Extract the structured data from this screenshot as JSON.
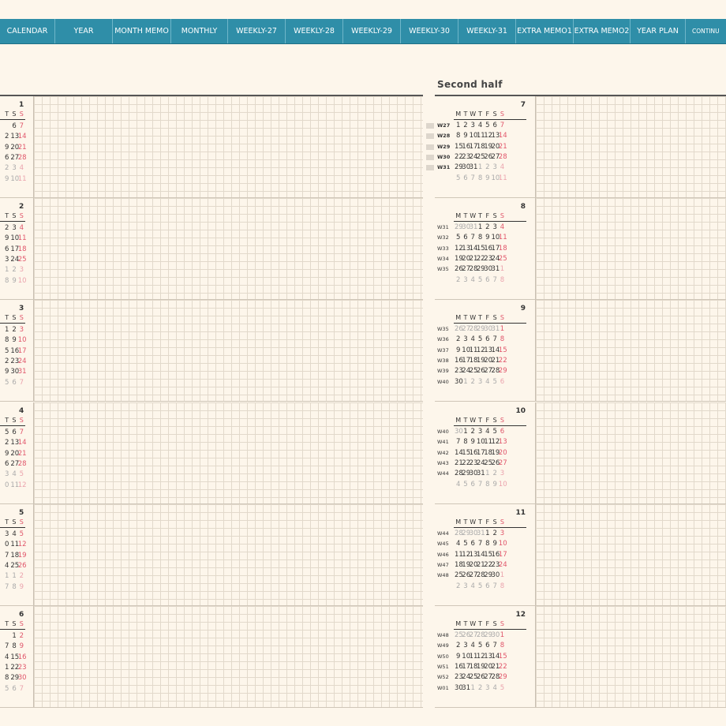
{
  "tabs": [
    "CALENDAR",
    "YEAR",
    "MONTH MEMO",
    "MONTHLY",
    "WEEKLY-27",
    "WEEKLY-28",
    "WEEKLY-29",
    "WEEKLY-30",
    "WEEKLY-31",
    "EXTRA MEMO1",
    "EXTRA MEMO2",
    "YEAR PLAN",
    "CONTINU"
  ],
  "second_half_title": "Second half",
  "weekday_headers": [
    "M",
    "T",
    "W",
    "T",
    "F",
    "S",
    "S"
  ],
  "colors": {
    "tab_bar": "#2f8ea8",
    "background": "#fdf6eb",
    "sunday": "#e0556a",
    "muted": "#aaaaaa"
  },
  "first_half": [
    {
      "month": "1",
      "header": [
        "T",
        "S",
        "S"
      ],
      "rows": [
        [
          {
            "t": "6"
          },
          {
            "t": "7",
            "s": 1
          }
        ],
        [
          {
            "t": "2"
          },
          {
            "t": "13"
          },
          {
            "t": "14",
            "s": 1
          }
        ],
        [
          {
            "t": "9"
          },
          {
            "t": "20"
          },
          {
            "t": "21",
            "s": 1
          }
        ],
        [
          {
            "t": "6"
          },
          {
            "t": "27"
          },
          {
            "t": "28",
            "s": 1
          }
        ],
        [
          {
            "t": "2",
            "o": 1
          },
          {
            "t": "3",
            "o": 1
          },
          {
            "t": "4",
            "o": 1,
            "s": 1
          }
        ],
        [
          {
            "t": "9",
            "o": 1
          },
          {
            "t": "10",
            "o": 1
          },
          {
            "t": "11",
            "o": 1,
            "s": 1
          }
        ]
      ]
    },
    {
      "month": "2",
      "header": [
        "T",
        "S",
        "S"
      ],
      "rows": [
        [
          {
            "t": "2"
          },
          {
            "t": "3"
          },
          {
            "t": "4",
            "s": 1
          }
        ],
        [
          {
            "t": "9"
          },
          {
            "t": "10"
          },
          {
            "t": "11",
            "s": 1
          }
        ],
        [
          {
            "t": "6"
          },
          {
            "t": "17"
          },
          {
            "t": "18",
            "s": 1
          }
        ],
        [
          {
            "t": "3"
          },
          {
            "t": "24"
          },
          {
            "t": "25",
            "s": 1
          }
        ],
        [
          {
            "t": "1",
            "o": 1
          },
          {
            "t": "2",
            "o": 1
          },
          {
            "t": "3",
            "o": 1,
            "s": 1
          }
        ],
        [
          {
            "t": "8",
            "o": 1
          },
          {
            "t": "9",
            "o": 1
          },
          {
            "t": "10",
            "o": 1,
            "s": 1
          }
        ]
      ]
    },
    {
      "month": "3",
      "header": [
        "T",
        "S",
        "S"
      ],
      "rows": [
        [
          {
            "t": "1"
          },
          {
            "t": "2"
          },
          {
            "t": "3",
            "s": 1
          }
        ],
        [
          {
            "t": "8"
          },
          {
            "t": "9"
          },
          {
            "t": "10",
            "s": 1
          }
        ],
        [
          {
            "t": "5"
          },
          {
            "t": "16"
          },
          {
            "t": "17",
            "s": 1
          }
        ],
        [
          {
            "t": "2"
          },
          {
            "t": "23"
          },
          {
            "t": "24",
            "s": 1
          }
        ],
        [
          {
            "t": "9"
          },
          {
            "t": "30"
          },
          {
            "t": "31",
            "s": 1
          }
        ],
        [
          {
            "t": "5",
            "o": 1
          },
          {
            "t": "6",
            "o": 1
          },
          {
            "t": "7",
            "o": 1,
            "s": 1
          }
        ]
      ]
    },
    {
      "month": "4",
      "header": [
        "T",
        "S",
        "S"
      ],
      "rows": [
        [
          {
            "t": "5"
          },
          {
            "t": "6"
          },
          {
            "t": "7",
            "s": 1
          }
        ],
        [
          {
            "t": "2"
          },
          {
            "t": "13"
          },
          {
            "t": "14",
            "s": 1
          }
        ],
        [
          {
            "t": "9"
          },
          {
            "t": "20"
          },
          {
            "t": "21",
            "s": 1
          }
        ],
        [
          {
            "t": "6"
          },
          {
            "t": "27"
          },
          {
            "t": "28",
            "s": 1
          }
        ],
        [
          {
            "t": "3",
            "o": 1
          },
          {
            "t": "4",
            "o": 1
          },
          {
            "t": "5",
            "o": 1,
            "s": 1
          }
        ],
        [
          {
            "t": "0",
            "o": 1
          },
          {
            "t": "11",
            "o": 1
          },
          {
            "t": "12",
            "o": 1,
            "s": 1
          }
        ]
      ]
    },
    {
      "month": "5",
      "header": [
        "T",
        "S",
        "S"
      ],
      "rows": [
        [
          {
            "t": "3"
          },
          {
            "t": "4"
          },
          {
            "t": "5",
            "s": 1
          }
        ],
        [
          {
            "t": "0"
          },
          {
            "t": "11"
          },
          {
            "t": "12",
            "s": 1
          }
        ],
        [
          {
            "t": "7"
          },
          {
            "t": "18"
          },
          {
            "t": "19",
            "s": 1
          }
        ],
        [
          {
            "t": "4"
          },
          {
            "t": "25"
          },
          {
            "t": "26",
            "s": 1
          }
        ],
        [
          {
            "t": "1",
            "o": 1
          },
          {
            "t": "1",
            "o": 1
          },
          {
            "t": "2",
            "o": 1,
            "s": 1
          }
        ],
        [
          {
            "t": "7",
            "o": 1
          },
          {
            "t": "8",
            "o": 1
          },
          {
            "t": "9",
            "o": 1,
            "s": 1
          }
        ]
      ]
    },
    {
      "month": "6",
      "header": [
        "T",
        "S",
        "S"
      ],
      "rows": [
        [
          {
            "t": "1"
          },
          {
            "t": "2",
            "s": 1
          }
        ],
        [
          {
            "t": "7"
          },
          {
            "t": "8"
          },
          {
            "t": "9",
            "s": 1
          }
        ],
        [
          {
            "t": "4"
          },
          {
            "t": "15"
          },
          {
            "t": "16",
            "s": 1
          }
        ],
        [
          {
            "t": "1"
          },
          {
            "t": "22"
          },
          {
            "t": "23",
            "s": 1
          }
        ],
        [
          {
            "t": "8"
          },
          {
            "t": "29"
          },
          {
            "t": "30",
            "s": 1
          }
        ],
        [
          {
            "t": "5",
            "o": 1
          },
          {
            "t": "6",
            "o": 1
          },
          {
            "t": "7",
            "o": 1,
            "s": 1
          }
        ]
      ]
    }
  ],
  "second_half": [
    {
      "month": "7",
      "weeks": [
        "W27",
        "W28",
        "W29",
        "W30",
        "W31",
        ""
      ],
      "bold_weeks": true,
      "rows": [
        [
          1,
          2,
          3,
          4,
          5,
          6,
          7
        ],
        [
          8,
          9,
          10,
          11,
          12,
          13,
          14
        ],
        [
          15,
          16,
          17,
          18,
          19,
          20,
          21
        ],
        [
          22,
          23,
          24,
          25,
          26,
          27,
          28
        ],
        [
          29,
          30,
          31,
          "o1",
          "o2",
          "o3",
          "o4"
        ],
        [
          "o5",
          "o6",
          "o7",
          "o8",
          "o9",
          "o10",
          "o11"
        ]
      ]
    },
    {
      "month": "8",
      "weeks": [
        "W31",
        "W32",
        "W33",
        "W34",
        "W35",
        ""
      ],
      "rows": [
        [
          "o29",
          "o30",
          "o31",
          1,
          2,
          3,
          4
        ],
        [
          5,
          6,
          7,
          8,
          9,
          10,
          11
        ],
        [
          12,
          13,
          14,
          15,
          16,
          17,
          18
        ],
        [
          19,
          20,
          21,
          22,
          23,
          24,
          25
        ],
        [
          26,
          27,
          28,
          29,
          30,
          31,
          "o1"
        ],
        [
          "o2",
          "o3",
          "o4",
          "o5",
          "o6",
          "o7",
          "o8"
        ]
      ]
    },
    {
      "month": "9",
      "weeks": [
        "W35",
        "W36",
        "W37",
        "W38",
        "W39",
        "W40"
      ],
      "rows": [
        [
          "o26",
          "o27",
          "o28",
          "o29",
          "o30",
          "o31",
          1
        ],
        [
          2,
          3,
          4,
          5,
          6,
          7,
          8
        ],
        [
          9,
          10,
          11,
          12,
          13,
          14,
          15
        ],
        [
          16,
          17,
          18,
          19,
          20,
          21,
          22
        ],
        [
          23,
          24,
          25,
          26,
          27,
          28,
          29
        ],
        [
          30,
          "o1",
          "o2",
          "o3",
          "o4",
          "o5",
          "o6"
        ]
      ]
    },
    {
      "month": "10",
      "weeks": [
        "W40",
        "W41",
        "W42",
        "W43",
        "W44",
        ""
      ],
      "rows": [
        [
          "o30",
          1,
          2,
          3,
          4,
          5,
          6
        ],
        [
          7,
          8,
          9,
          10,
          11,
          12,
          13
        ],
        [
          14,
          15,
          16,
          17,
          18,
          19,
          20
        ],
        [
          21,
          22,
          23,
          24,
          25,
          26,
          27
        ],
        [
          28,
          29,
          30,
          31,
          "o1",
          "o2",
          "o3"
        ],
        [
          "o4",
          "o5",
          "o6",
          "o7",
          "o8",
          "o9",
          "o10"
        ]
      ]
    },
    {
      "month": "11",
      "weeks": [
        "W44",
        "W45",
        "W46",
        "W47",
        "W48",
        ""
      ],
      "rows": [
        [
          "o28",
          "o29",
          "o30",
          "o31",
          1,
          2,
          3
        ],
        [
          4,
          5,
          6,
          7,
          8,
          9,
          10
        ],
        [
          11,
          12,
          13,
          14,
          15,
          16,
          17
        ],
        [
          18,
          19,
          20,
          21,
          22,
          23,
          24
        ],
        [
          25,
          26,
          27,
          28,
          29,
          30,
          "o1"
        ],
        [
          "o2",
          "o3",
          "o4",
          "o5",
          "o6",
          "o7",
          "o8"
        ]
      ]
    },
    {
      "month": "12",
      "weeks": [
        "W48",
        "W49",
        "W50",
        "W51",
        "W52",
        "W01"
      ],
      "rows": [
        [
          "o25",
          "o26",
          "o27",
          "o28",
          "o29",
          "o30",
          1
        ],
        [
          2,
          3,
          4,
          5,
          6,
          7,
          8
        ],
        [
          9,
          10,
          11,
          12,
          13,
          14,
          15
        ],
        [
          16,
          17,
          18,
          19,
          20,
          21,
          22
        ],
        [
          23,
          24,
          25,
          26,
          27,
          28,
          29
        ],
        [
          30,
          31,
          "o1",
          "o2",
          "o3",
          "o4",
          "o5"
        ]
      ]
    }
  ]
}
